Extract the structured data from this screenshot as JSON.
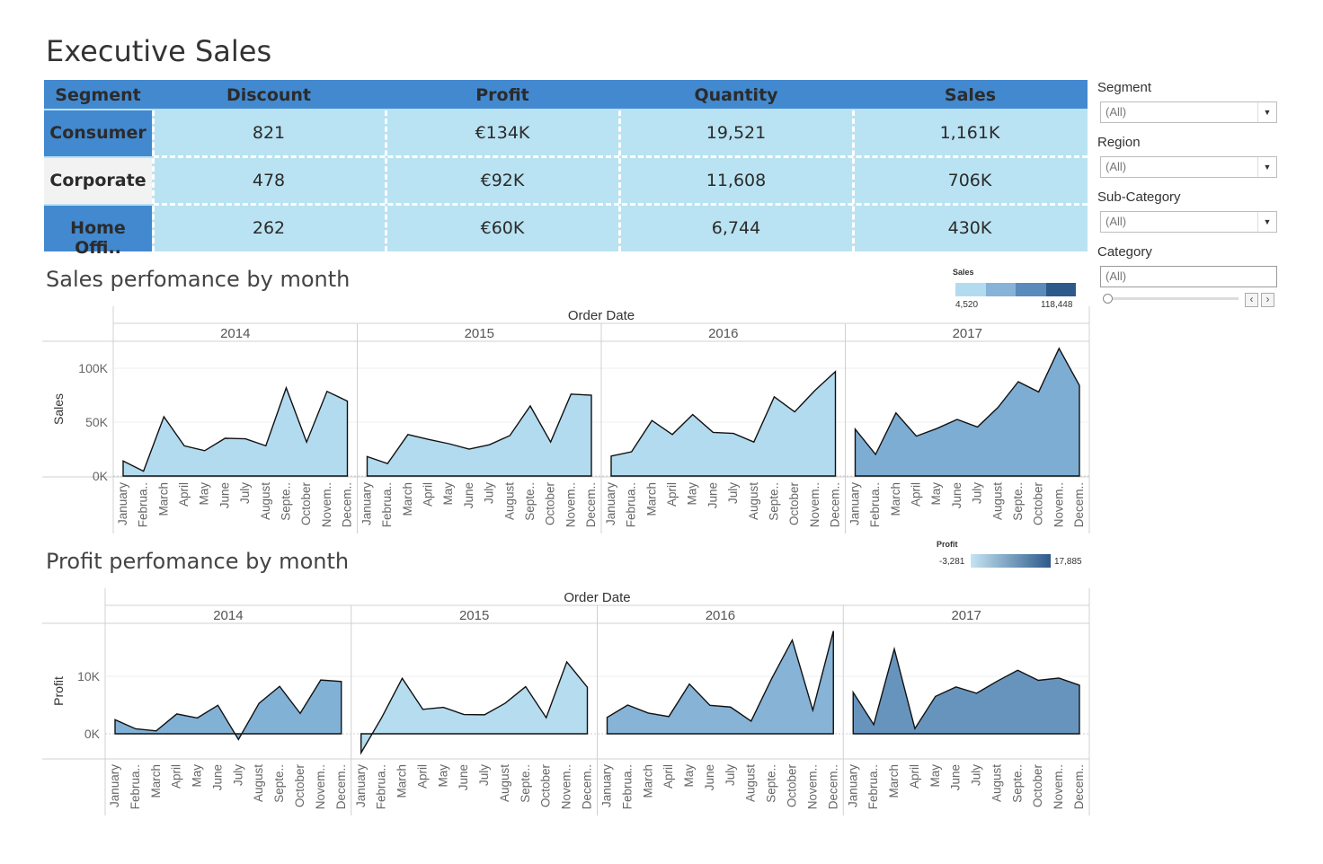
{
  "page_title": "Executive Sales",
  "kpi_table": {
    "headers": [
      "Segment",
      "Discount",
      "Profit",
      "Quantity",
      "Sales"
    ],
    "rows": [
      {
        "segment": "Consumer",
        "discount": "821",
        "profit": "€134K",
        "quantity": "19,521",
        "sales": "1,161K"
      },
      {
        "segment": "Corporate",
        "discount": "478",
        "profit": "€92K",
        "quantity": "11,608",
        "sales": "706K"
      },
      {
        "segment": "Home Offi..",
        "discount": "262",
        "profit": "€60K",
        "quantity": "6,744",
        "sales": "430K"
      }
    ]
  },
  "filters": {
    "segment": {
      "label": "Segment",
      "value": "(All)"
    },
    "region": {
      "label": "Region",
      "value": "(All)"
    },
    "sub_category": {
      "label": "Sub-Category",
      "value": "(All)"
    },
    "category": {
      "label": "Category",
      "value": "(All)"
    }
  },
  "colors": {
    "header_blue": "#4289d0",
    "cell_light": "#b9e3f2",
    "corporate_row_bg": "#f2f2f2",
    "series_fill_light": "#b3dbef",
    "series_fill_mid": "#7fafd5",
    "series_fill_dark": "#6794bd"
  },
  "icons": {
    "dropdown": "chevron-down-icon",
    "slider_prev": "chevron-left-icon",
    "slider_next": "chevron-right-icon"
  },
  "chart_data": [
    {
      "type": "area",
      "title": "Sales perfomance by month",
      "column_header": "Order Date",
      "ylabel": "Sales",
      "ylim": [
        0,
        130000
      ],
      "yticks": [
        "0K",
        "50K",
        "100K"
      ],
      "years": [
        "2014",
        "2015",
        "2016",
        "2017"
      ],
      "x_tick_labels": [
        "January",
        "Februa..",
        "March",
        "April",
        "May",
        "June",
        "July",
        "August",
        "Septe..",
        "October",
        "Novem..",
        "Decem.."
      ],
      "legend": {
        "title": "Sales",
        "min": "4,520",
        "max": "118,448"
      },
      "series": [
        {
          "year": "2014",
          "fill": "#b3dbef",
          "values": [
            14000,
            4500,
            55000,
            28000,
            23500,
            35000,
            34500,
            28000,
            81800,
            31500,
            78500,
            69500
          ]
        },
        {
          "year": "2015",
          "fill": "#b3dbef",
          "values": [
            18000,
            11500,
            38500,
            34000,
            30000,
            25000,
            29000,
            37500,
            65000,
            31500,
            76000,
            75000
          ]
        },
        {
          "year": "2016",
          "fill": "#b3dbef",
          "values": [
            18500,
            22500,
            51500,
            38500,
            57000,
            40500,
            39500,
            31500,
            73500,
            59500,
            79500,
            96900
          ]
        },
        {
          "year": "2017",
          "fill": "#7eadd4",
          "values": [
            43500,
            20000,
            58500,
            37000,
            44000,
            52500,
            45500,
            63500,
            87500,
            78000,
            118400,
            84000
          ]
        }
      ]
    },
    {
      "type": "area",
      "title": "Profit perfomance by month",
      "column_header": "Order Date",
      "ylabel": "Profit",
      "ylim": [
        -5000,
        20000
      ],
      "yticks": [
        "0K",
        "10K"
      ],
      "years": [
        "2014",
        "2015",
        "2016",
        "2017"
      ],
      "x_tick_labels": [
        "January",
        "Februa..",
        "March",
        "April",
        "May",
        "June",
        "July",
        "August",
        "Septe..",
        "October",
        "Novem..",
        "Decem.."
      ],
      "legend": {
        "title": "Profit",
        "min": "-3,281",
        "max": "17,885"
      },
      "series": [
        {
          "year": "2014",
          "fill": "#82b1d6",
          "values": [
            2450,
            860,
            500,
            3450,
            2750,
            4950,
            -1000,
            5300,
            8250,
            3550,
            9350,
            9100
          ]
        },
        {
          "year": "2015",
          "fill": "#b5dcef",
          "values": [
            -3300,
            2800,
            9650,
            4250,
            4600,
            3350,
            3300,
            5300,
            8200,
            2800,
            12500,
            8100
          ]
        },
        {
          "year": "2016",
          "fill": "#86b3d6",
          "values": [
            2850,
            5000,
            3600,
            3000,
            8650,
            4950,
            4650,
            2200,
            9600,
            16300,
            4100,
            17885
          ]
        },
        {
          "year": "2017",
          "fill": "#6794bd",
          "values": [
            7200,
            1600,
            14750,
            900,
            6500,
            8150,
            7050,
            9150,
            11050,
            9300,
            9700,
            8450
          ]
        }
      ]
    }
  ]
}
